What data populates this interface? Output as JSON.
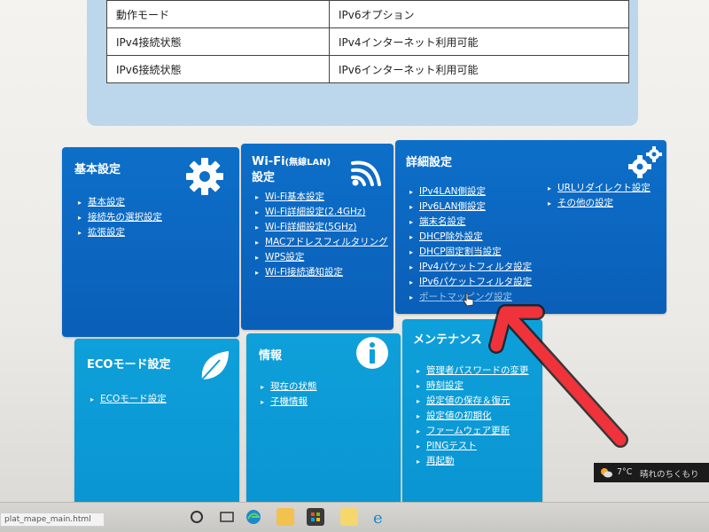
{
  "status_table": {
    "rows": [
      {
        "key": "動作モード",
        "value": "IPv6オプション"
      },
      {
        "key": "IPv4接続状態",
        "value": "IPv4インターネット利用可能"
      },
      {
        "key": "IPv6接続状態",
        "value": "IPv6インターネット利用可能"
      }
    ]
  },
  "tiles": {
    "basic": {
      "title": "基本設定",
      "links": [
        "基本設定",
        "接続先の選択設定",
        "拡張設定"
      ]
    },
    "wifi": {
      "title_main": "Wi-Fi",
      "title_small": "(無線LAN)",
      "title_line2": "設定",
      "links": [
        "Wi-Fi基本設定",
        "Wi-Fi詳細設定(2.4GHz)",
        "Wi-Fi詳細設定(5GHz)",
        "MACアドレスフィルタリング",
        "WPS設定",
        "Wi-Fi接続通知設定"
      ]
    },
    "advanced": {
      "title": "詳細設定",
      "links_left": [
        "IPv4LAN側設定",
        "IPv6LAN側設定",
        "端末名設定",
        "DHCP除外設定",
        "DHCP固定割当設定",
        "IPv4パケットフィルタ設定",
        "IPv6パケットフィルタ設定",
        "ポートマッピング設定"
      ],
      "links_right": [
        "URLリダイレクト設定",
        "その他の設定"
      ]
    },
    "eco": {
      "title": "ECOモード設定",
      "links": [
        "ECOモード設定"
      ]
    },
    "info": {
      "title": "情報",
      "links": [
        "現在の状態",
        "子機情報"
      ]
    },
    "maintenance": {
      "title": "メンテナンス",
      "links": [
        "管理者パスワードの変更",
        "時刻設定",
        "設定値の保存＆復元",
        "設定値の初期化",
        "ファームウェア更新",
        "PINGテスト",
        "再起動"
      ]
    }
  },
  "taskbar": {
    "filename": "plat_mape_main.html",
    "weather_temp": "7°C",
    "weather_text": "晴れのちくもり"
  },
  "colors": {
    "tile_dark": "#0a5fb8",
    "tile_light": "#0a95d2",
    "panel": "#bcd7ec",
    "arrow": "#f0323a"
  },
  "icons": [
    "gear-icon",
    "wifi-icon",
    "gears-icon",
    "leaf-icon",
    "info-icon",
    "mouse-cursor-icon",
    "red-arrow-annotation",
    "windows-start-icon",
    "edge-icon",
    "file-explorer-icon",
    "store-icon",
    "sticky-notes-icon",
    "ie-icon"
  ]
}
